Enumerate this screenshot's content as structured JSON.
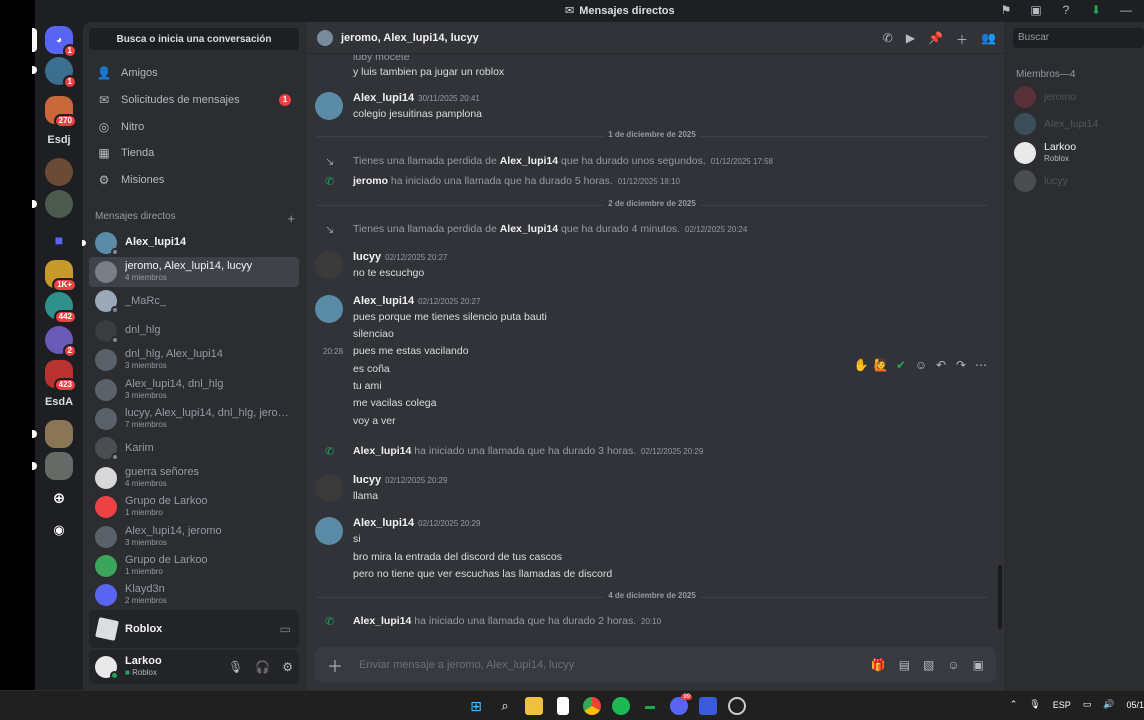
{
  "window": {
    "title": "Mensajes directos"
  },
  "rail": {
    "servers": [
      {
        "name": "discord-home",
        "badge": "1",
        "color": "#5865f2"
      },
      {
        "name": "server-1",
        "badge": "1",
        "color": "#3b6f8f"
      },
      {
        "name": "server-2",
        "badge": "270",
        "color": "#c9683a"
      },
      {
        "name": "server-esdj",
        "label": "Esdj"
      },
      {
        "name": "server-3",
        "color": "#6b4a36"
      },
      {
        "name": "server-4",
        "color": "#4d5a4f"
      },
      {
        "name": "server-folder",
        "color": "#5865f2"
      },
      {
        "name": "server-5",
        "badge": "1K+",
        "color": "#c79a2b"
      },
      {
        "name": "server-6",
        "badge": "442",
        "color": "#2f8f8a"
      },
      {
        "name": "server-7",
        "badge": "2",
        "color": "#6a5ab8"
      },
      {
        "name": "server-8",
        "badge": "423",
        "color": "#b8322f"
      },
      {
        "name": "server-esda",
        "label": "EsdA"
      },
      {
        "name": "server-9",
        "color": "#8a7656"
      },
      {
        "name": "server-10",
        "color": "#666a66"
      }
    ]
  },
  "sidebar": {
    "search": "Busca o inicia una conversación",
    "nav": [
      {
        "label": "Amigos",
        "icon": "friends-icon"
      },
      {
        "label": "Solicitudes de mensajes",
        "icon": "mail-icon",
        "badge": "1"
      },
      {
        "label": "Nitro",
        "icon": "nitro-icon"
      },
      {
        "label": "Tienda",
        "icon": "shop-icon"
      },
      {
        "label": "Misiones",
        "icon": "quests-icon"
      }
    ],
    "dm_header": "Mensajes directos",
    "dm_add": "+",
    "dms": [
      {
        "name": "Alex_lupi14",
        "sub": "",
        "color": "#5a8ca8",
        "status": "off"
      },
      {
        "name": "jeromo, Alex_lupi14, lucyy",
        "sub": "4 miembros",
        "color": "#7a7e86",
        "status": "none"
      },
      {
        "name": "_MaRc_",
        "sub": "",
        "color": "#9aa8b8",
        "status": "off"
      },
      {
        "name": "dnl_hlg",
        "sub": "",
        "color": "#3a3c3f",
        "status": "off"
      },
      {
        "name": "dnl_hlg, Alex_lupi14",
        "sub": "3 miembros",
        "color": "#5b6169",
        "status": "none"
      },
      {
        "name": "Alex_lupi14, dnl_hlg",
        "sub": "3 miembros",
        "color": "#5b6169",
        "status": "none"
      },
      {
        "name": "lucyy, Alex_lupi14, dnl_hlg, jeromo...",
        "sub": "7 miembros",
        "color": "#5b6169",
        "status": "none"
      },
      {
        "name": "Karim",
        "sub": "",
        "color": "#4b4d52",
        "status": "off"
      },
      {
        "name": "guerra señores",
        "sub": "4 miembros",
        "color": "#d8d8d8",
        "status": "none"
      },
      {
        "name": "Grupo de Larkoo",
        "sub": "1 miembro",
        "color": "#ed4245",
        "status": "none"
      },
      {
        "name": "Alex_lupi14, jeromo",
        "sub": "3 miembros",
        "color": "#5b6169",
        "status": "none"
      },
      {
        "name": "Grupo de Larkoo",
        "sub": "1 miembro",
        "color": "#3ba55c",
        "status": "none"
      },
      {
        "name": "Klayd3n",
        "sub": "2 miembros",
        "color": "#5865f2",
        "status": "none"
      }
    ],
    "activity": {
      "game": "Roblox"
    },
    "user": {
      "name": "Larkoo",
      "status": "Roblox"
    }
  },
  "chat": {
    "header_title": "jeromo, Alex_lupi14, lucyy",
    "top_lines": [
      "luby mocete",
      "y luis tambien pa jugar un roblox"
    ],
    "msg1": {
      "author": "Alex_lupi14",
      "time": "30/11/2025 20:41",
      "lines": [
        "colegio jesuitinas pamplona"
      ]
    },
    "divider1": "1 de diciembre de 2025",
    "sys1": {
      "pre": "Tienes una llamada perdida de ",
      "who": "Alex_lupi14",
      "post": " que ha durado unos segundos.",
      "time": "01/12/2025 17:58"
    },
    "sys2": {
      "who": "jeromo",
      "post": " ha iniciado una llamada que ha durado 5 horas.",
      "time": "01/12/2025 18:10"
    },
    "divider2": "2 de diciembre de 2025",
    "sys3": {
      "pre": "Tienes una llamada perdida de ",
      "who": "Alex_lupi14",
      "post": " que ha durado 4 minutos.",
      "time": "02/12/2025 20:24"
    },
    "msg2": {
      "author": "lucyy",
      "time": "02/12/2025 20:27",
      "lines": [
        "no te escuchgo"
      ]
    },
    "msg3": {
      "author": "Alex_lupi14",
      "time": "02/12/2025 20:27",
      "lines": [
        "pues porque me tienes  silencio puta bauti",
        "silenciao",
        "pues me estas vacilando",
        "es coña",
        "tu ami",
        "me vacilas colega",
        "voy a ver"
      ],
      "hover_time": "20:28"
    },
    "sys4": {
      "who": "Alex_lupi14",
      "post": " ha iniciado una llamada que ha durado 3 horas.",
      "time": "02/12/2025 20:29"
    },
    "msg4": {
      "author": "lucyy",
      "time": "02/12/2025 20:29",
      "lines": [
        "llama"
      ]
    },
    "msg5": {
      "author": "Alex_lupi14",
      "time": "02/12/2025 20:29",
      "lines": [
        "si",
        "bro mira la entrada del discord de tus cascos",
        "pero no tiene que ver escuchas las llamadas de discord"
      ]
    },
    "divider3": "4 de diciembre de 2025",
    "sys5": {
      "who": "Alex_lupi14",
      "post": " ha iniciado una llamada que ha durado 2 horas.",
      "time": "20:10"
    },
    "composer_placeholder": "Enviar mensaje a jeromo, Alex_lupi14, lucyy"
  },
  "members": {
    "search": "Buscar",
    "header": "Miembros—4",
    "list": [
      {
        "name": "jeromo",
        "sub": "",
        "state": "offline",
        "color": "#b23a48"
      },
      {
        "name": "Alex_lupi14",
        "sub": "",
        "state": "offline",
        "color": "#5a8ca8"
      },
      {
        "name": "Larkoo",
        "sub": "Roblox",
        "state": "online",
        "color": "#e9e9e9"
      },
      {
        "name": "lucyy",
        "sub": "",
        "state": "offline",
        "color": "#888"
      }
    ]
  },
  "taskbar": {
    "lang": "ESP",
    "date": "05/1",
    "discord_badge": "99"
  }
}
